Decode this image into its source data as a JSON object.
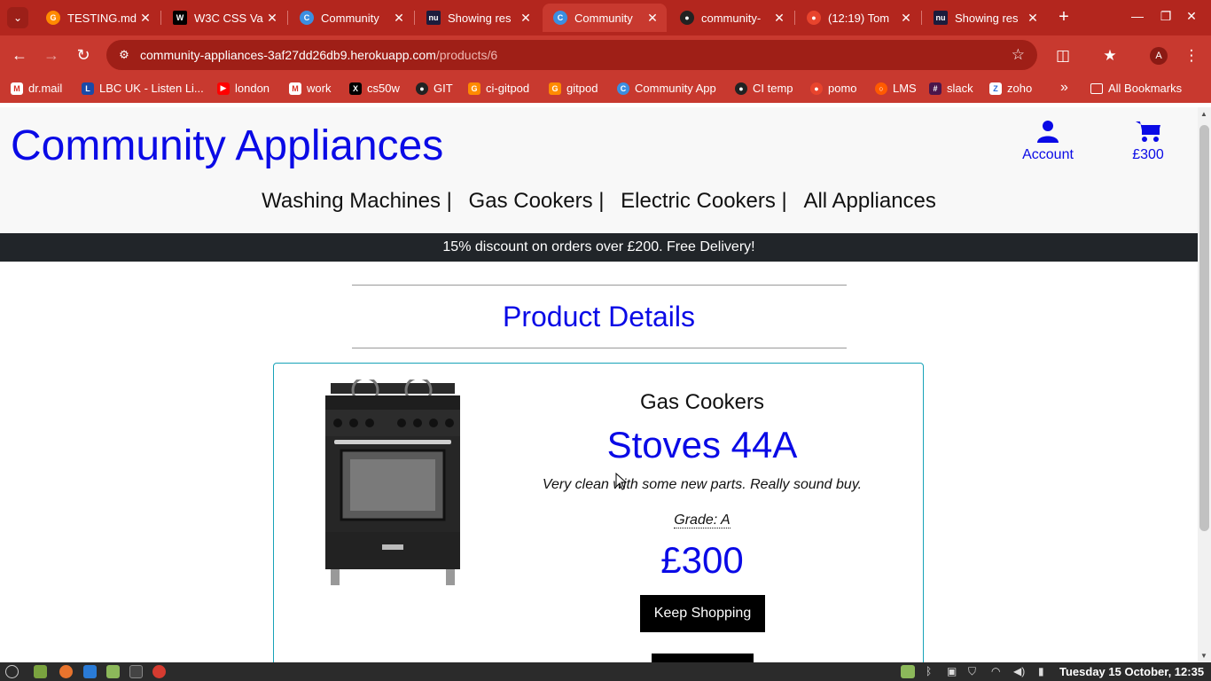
{
  "browser": {
    "tabs": [
      {
        "title": "TESTING.md",
        "icon": "gitpod-icon",
        "active": false
      },
      {
        "title": "W3C CSS Va",
        "icon": "w3c-icon",
        "active": false
      },
      {
        "title": "Community",
        "icon": "community-app-icon",
        "active": false
      },
      {
        "title": "Showing res",
        "icon": "nu-icon",
        "active": false
      },
      {
        "title": "Community",
        "icon": "community-app-icon",
        "active": true
      },
      {
        "title": "community-",
        "icon": "github-icon",
        "active": false
      },
      {
        "title": "(12:19) Tom",
        "icon": "tomato-icon",
        "active": false
      },
      {
        "title": "Showing res",
        "icon": "nu-icon",
        "active": false
      }
    ],
    "url_host": "community-appliances-3af27dd26db9.herokuapp.com",
    "url_path": "/products/6",
    "profile_initial": "A",
    "bookmarks": [
      {
        "label": "dr.mail",
        "icon": "gmail-icon"
      },
      {
        "label": "LBC UK - Listen Li...",
        "icon": "lbc-icon"
      },
      {
        "label": "london",
        "icon": "youtube-icon"
      },
      {
        "label": "work",
        "icon": "gmail-icon"
      },
      {
        "label": "cs50w",
        "icon": "x-icon"
      },
      {
        "label": "GIT",
        "icon": "github-icon"
      },
      {
        "label": "ci-gitpod",
        "icon": "gitpod-icon"
      },
      {
        "label": "gitpod",
        "icon": "gitpod-icon"
      },
      {
        "label": "Community App",
        "icon": "community-app-icon"
      },
      {
        "label": "CI temp",
        "icon": "github-icon"
      },
      {
        "label": "pomo",
        "icon": "tomato-icon"
      },
      {
        "label": "LMS",
        "icon": "lms-icon"
      },
      {
        "label": "slack",
        "icon": "slack-icon"
      },
      {
        "label": "zoho",
        "icon": "zoho-icon"
      }
    ],
    "more_bookmarks": "»",
    "all_bookmarks": "All Bookmarks"
  },
  "site": {
    "brand": "Community Appliances",
    "account_label": "Account",
    "cart_total": "£300",
    "nav": [
      "Washing Machines |",
      "Gas Cookers |",
      "Electric Cookers |",
      "All Appliances"
    ],
    "promo": "15% discount on orders over £200. Free Delivery!",
    "heading": "Product Details",
    "product": {
      "category": "Gas Cookers",
      "name": "Stoves 44A",
      "description": "Very clean with some new parts. Really sound buy.",
      "grade": "Grade: A",
      "price": "£300",
      "keep_shopping": "Keep Shopping"
    }
  },
  "taskbar": {
    "clock": "Tuesday 15 October, 12:35"
  },
  "colors": {
    "chrome_red": "#c8392f",
    "brand_blue": "#0a0ae6",
    "promo_dark": "#212529",
    "card_border": "#17a2b8"
  }
}
